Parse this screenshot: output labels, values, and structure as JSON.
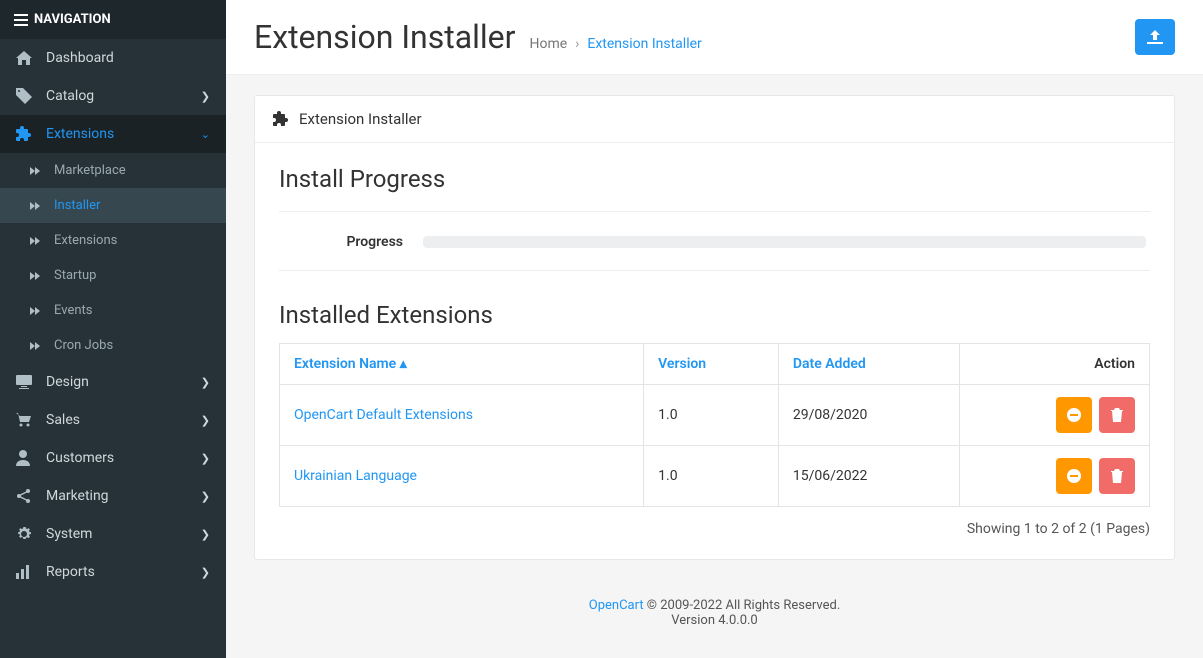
{
  "nav": {
    "header": "NAVIGATION",
    "items": [
      {
        "label": "Dashboard"
      },
      {
        "label": "Catalog",
        "expandable": true
      },
      {
        "label": "Extensions",
        "expandable": true,
        "active": true,
        "children": [
          {
            "label": "Marketplace"
          },
          {
            "label": "Installer",
            "active": true
          },
          {
            "label": "Extensions"
          },
          {
            "label": "Startup"
          },
          {
            "label": "Events"
          },
          {
            "label": "Cron Jobs"
          }
        ]
      },
      {
        "label": "Design",
        "expandable": true
      },
      {
        "label": "Sales",
        "expandable": true
      },
      {
        "label": "Customers",
        "expandable": true
      },
      {
        "label": "Marketing",
        "expandable": true
      },
      {
        "label": "System",
        "expandable": true
      },
      {
        "label": "Reports",
        "expandable": true
      }
    ]
  },
  "header": {
    "title": "Extension Installer",
    "breadcrumb_home": "Home",
    "breadcrumb_sep": "›",
    "breadcrumb_current": "Extension Installer"
  },
  "panel": {
    "title": "Extension Installer",
    "install_progress_title": "Install Progress",
    "progress_label": "Progress",
    "installed_title": "Installed Extensions",
    "columns": {
      "name": "Extension Name",
      "version": "Version",
      "date": "Date Added",
      "action": "Action"
    },
    "rows": [
      {
        "name": "OpenCart Default Extensions",
        "version": "1.0",
        "date": "29/08/2020"
      },
      {
        "name": "Ukrainian Language",
        "version": "1.0",
        "date": "15/06/2022"
      }
    ],
    "pagination": "Showing 1 to 2 of 2 (1 Pages)"
  },
  "footer": {
    "link": "OpenCart",
    "copyright": " © 2009-2022 All Rights Reserved.",
    "version": "Version 4.0.0.0"
  }
}
